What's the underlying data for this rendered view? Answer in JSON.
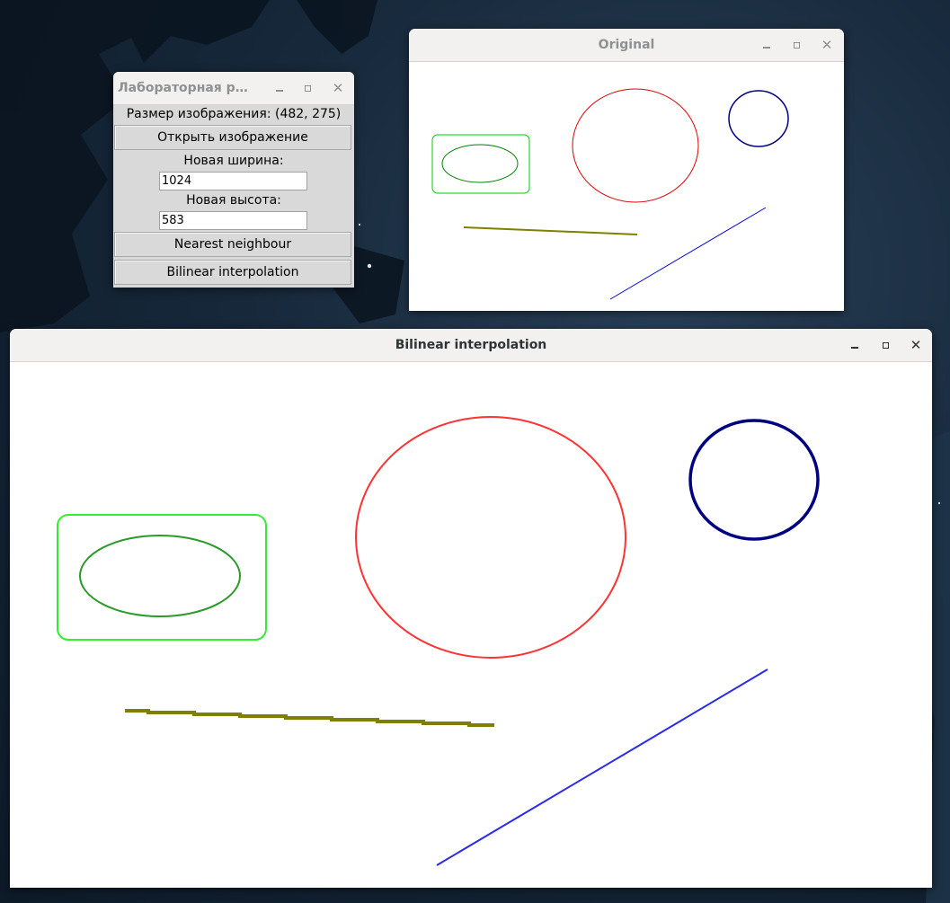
{
  "lab_window": {
    "title": "Лабораторная работ...",
    "image_size_label": "Размер изображения: (482, 275)",
    "open_button": "Открыть изображение",
    "width_label": "Новая ширина:",
    "width_value": "1024",
    "height_label": "Новая высота:",
    "height_value": "583",
    "nearest_button": "Nearest neighbour",
    "bilinear_button": "Bilinear interpolation"
  },
  "original_window": {
    "title": "Original"
  },
  "bilinear_window": {
    "title": "Bilinear interpolation"
  },
  "colors": {
    "green_rect": "#00cc00",
    "green_ellipse": "#008000",
    "red_ellipse": "#dd0000",
    "navy_circle": "#000080",
    "olive_line": "#808000",
    "blue_line": "#0000dd"
  },
  "icons": [
    "minimize-icon",
    "maximize-icon",
    "close-icon"
  ]
}
